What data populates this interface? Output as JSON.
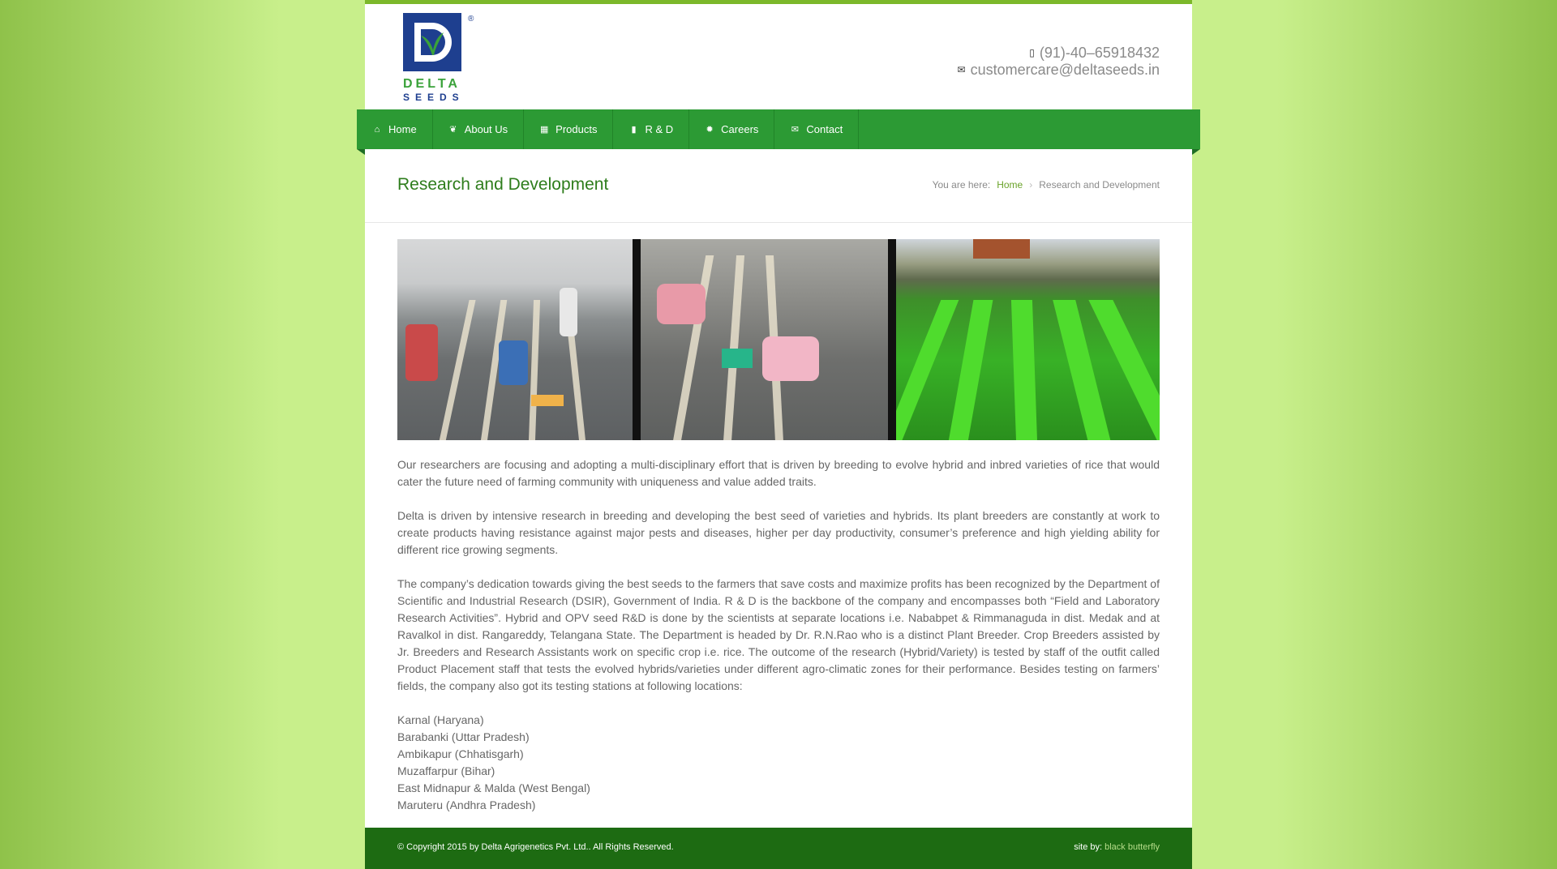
{
  "brand": {
    "logo_line1": "DELTA",
    "logo_line2": "SEEDS",
    "registered": "®"
  },
  "header": {
    "phone": "(91)-40–65918432",
    "email": "customercare@deltaseeds.in"
  },
  "nav": {
    "items": [
      {
        "label": "Home",
        "icon": "home-icon"
      },
      {
        "label": "About Us",
        "icon": "leaf-icon"
      },
      {
        "label": "Products",
        "icon": "grid-icon"
      },
      {
        "label": "R & D",
        "icon": "book-icon"
      },
      {
        "label": "Careers",
        "icon": "gear-icon"
      },
      {
        "label": "Contact",
        "icon": "mail-icon"
      }
    ]
  },
  "title_bar": {
    "title": "Research and Development",
    "breadcrumb_prefix": "You are here:",
    "breadcrumb_home": "Home",
    "breadcrumb_current": "Research and Development"
  },
  "content": {
    "paragraphs": [
      "Our researchers are focusing and adopting a multi-disciplinary effort that is driven by breeding to evolve hybrid and inbred varieties of rice that would cater the future need of farming community with uniqueness and value added traits.",
      "Delta is driven by intensive research in breeding and developing the best seed of varieties and hybrids. Its plant breeders are constantly at work to create products having resistance against major pests and diseases, higher per day productivity, consumer’s preference and high yielding ability for different rice growing segments.",
      "The company’s dedication towards giving the best seeds to the farmers that save costs and maximize profits has been recognized by the Department of Scientific and Industrial Research (DSIR), Government of India. R & D is the backbone of the company and encompasses both “Field and Laboratory Research Activities”. Hybrid and OPV seed R&D is done by the scientists at separate locations i.e. Nababpet & Rimmanaguda in dist. Medak and at Ravalkol in dist. Rangareddy, Telangana State. The Department is headed by Dr. R.N.Rao who is a distinct Plant Breeder. Crop Breeders assisted by Jr. Breeders and Research Assistants work on specific crop i.e. rice. The outcome of the research (Hybrid/Variety) is tested by staff of the outfit called Product Placement staff that tests the evolved hybrids/varieties under different agro-climatic zones for their performance. Besides testing on farmers’ fields, the company also got its testing stations at following locations:"
    ],
    "locations": [
      "Karnal (Haryana)",
      "Barabanki (Uttar Pradesh)",
      "Ambikapur (Chhatisgarh)",
      "Muzaffarpur (Bihar)",
      "East Midnapur & Malda (West Bengal)",
      "Maruteru (Andhra Pradesh)"
    ]
  },
  "footer": {
    "copyright": "© Copyright 2015 by Delta Agrigenetics Pvt. Ltd.. All Rights Reserved.",
    "site_by": "site by:",
    "credit": "black butterfly"
  },
  "colors": {
    "nav_green": "#2c9a34",
    "footer_green": "#1d6b12",
    "title_green": "#2e7d1c",
    "logo_blue": "#1e3f8f"
  }
}
